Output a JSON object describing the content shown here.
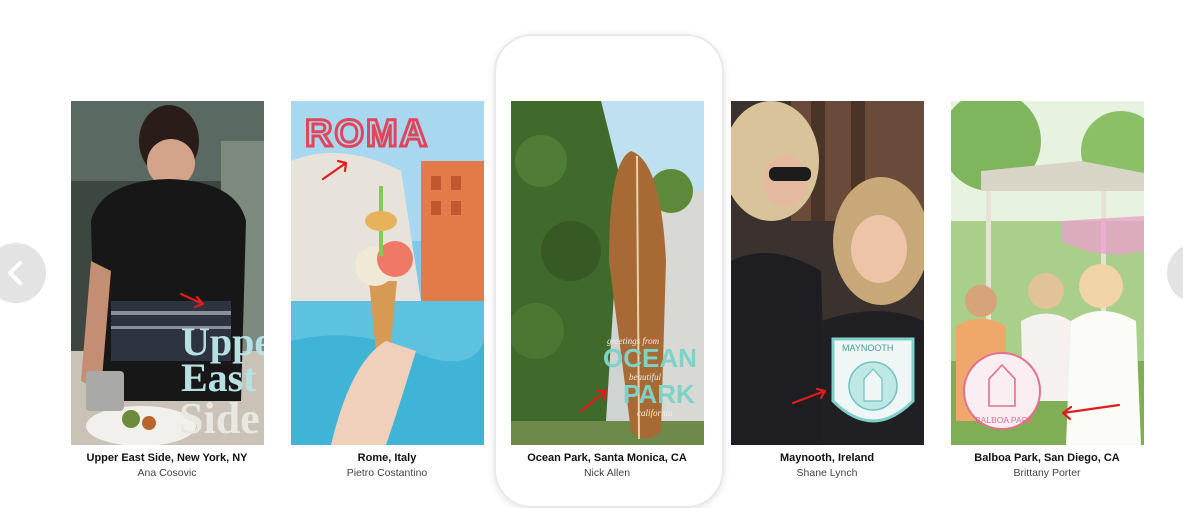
{
  "carousel": {
    "items": [
      {
        "location": "Upper East Side, New York, NY",
        "author": "Ana Cosovic",
        "geofilter": "upper east side",
        "colors": {
          "bg": "#3a4a40",
          "sticker": "#b7dfe2"
        }
      },
      {
        "location": "Rome, Italy",
        "author": "Pietro Costantino",
        "geofilter": "ROMA",
        "colors": {
          "bg": "#58bfe0",
          "sticker": "#e0455b"
        }
      },
      {
        "location": "Ocean Park, Santa Monica, CA",
        "author": "Nick Allen",
        "geofilter": "OCEAN PARK",
        "geofilter_top": "greetings from",
        "geofilter_mid": "beautiful",
        "geofilter_bottom": "california",
        "colors": {
          "bg": "#4d7a3a",
          "sticker": "#7fd2c8"
        }
      },
      {
        "location": "Maynooth, Ireland",
        "author": "Shane Lynch",
        "geofilter": "MAYNOOTH",
        "colors": {
          "bg": "#3b3532",
          "sticker": "#9fdad6"
        }
      },
      {
        "location": "Balboa Park, San Diego, CA",
        "author": "Brittany Porter",
        "geofilter": "BALBOA PARK",
        "colors": {
          "bg": "#9fc882",
          "sticker": "#e2708e"
        }
      }
    ]
  },
  "nav": {
    "prev_icon": "chevron-left-icon",
    "next_icon": "chevron-right-icon"
  },
  "accent": "#e01d1d"
}
